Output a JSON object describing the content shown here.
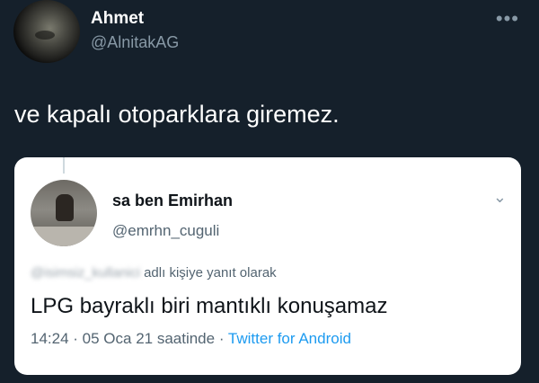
{
  "author": {
    "name": "Ahmet",
    "handle": "@AlnitakAG"
  },
  "more_label": "•••",
  "tweet_text": "ve kapalı otoparklara giremez.",
  "quoted": {
    "name": "sa ben Emirhan",
    "handle": "@emrhn_cuguli",
    "chevron": "⌄",
    "reply_blurred": "@isimsiz_kullanici",
    "reply_suffix": "adlı kişiye yanıt olarak",
    "text": "LPG bayraklı biri mantıklı konuşamaz",
    "time": "14:24",
    "sep1": " · ",
    "date": "05 Oca 21 saatinde",
    "sep2": " · ",
    "source": "Twitter for Android"
  },
  "colors": {
    "background": "#15202b",
    "link": "#1d9bf0",
    "secondary_text": "#8899a6"
  },
  "icons": {
    "more": "more-horizontal-icon",
    "chevron": "chevron-down-icon"
  }
}
